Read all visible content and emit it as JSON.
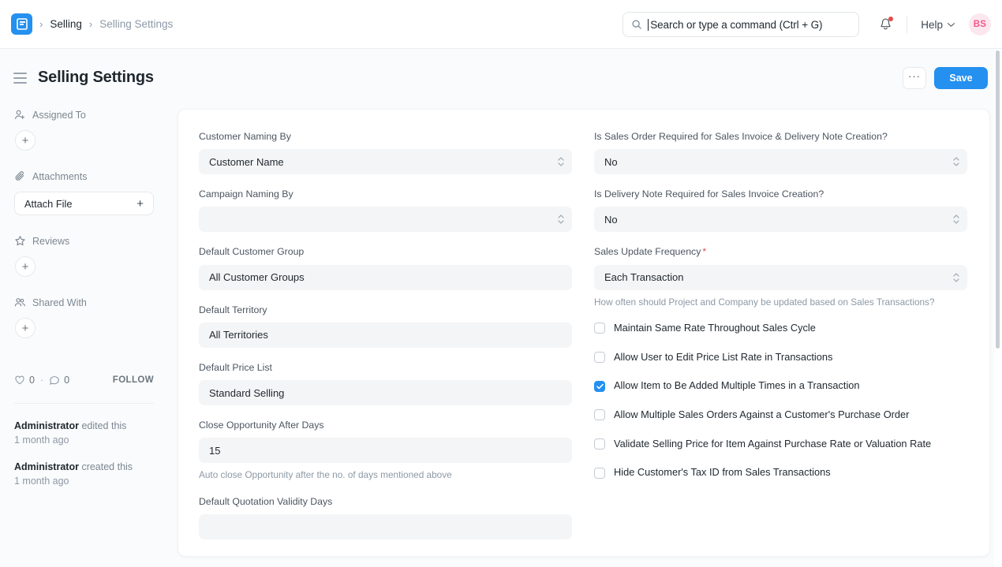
{
  "navbar": {
    "logo_alt": "frappe-logo",
    "breadcrumbs": [
      {
        "label": "Selling",
        "muted": false
      },
      {
        "label": "Selling Settings",
        "muted": true
      }
    ],
    "separator": "›",
    "search": {
      "placeholder": "Search or type a command (Ctrl + G)",
      "value": ""
    },
    "notifications_badge": true,
    "help_label": "Help",
    "avatar_initials": "BS"
  },
  "page_head": {
    "title": "Selling Settings",
    "menu_label": "···",
    "save_label": "Save"
  },
  "sidebar": {
    "sections": [
      {
        "label": "Assigned To",
        "icon": "user-plus-icon",
        "action": "add"
      },
      {
        "label": "Attachments",
        "icon": "paperclip-icon",
        "action": "attach",
        "button_label": "Attach File",
        "button_plus": "+"
      },
      {
        "label": "Reviews",
        "icon": "star-icon",
        "action": "add"
      },
      {
        "label": "Shared With",
        "icon": "users-icon",
        "action": "add"
      }
    ],
    "add_symbol": "+",
    "social": {
      "like_count": "0",
      "comment_count": "0",
      "separator": "·",
      "follow_label": "FOLLOW"
    },
    "activity": [
      {
        "user": "Administrator",
        "action": "edited this",
        "time": "1 month ago"
      },
      {
        "user": "Administrator",
        "action": "created this",
        "time": "1 month ago"
      }
    ]
  },
  "form": {
    "left_fields": [
      {
        "name": "customer-naming-by",
        "label": "Customer Naming By",
        "type": "select",
        "value": "Customer Name",
        "help": ""
      },
      {
        "name": "campaign-naming-by",
        "label": "Campaign Naming By",
        "type": "select",
        "value": "",
        "help": ""
      },
      {
        "name": "default-customer-group",
        "label": "Default Customer Group",
        "type": "link",
        "value": "All Customer Groups",
        "help": ""
      },
      {
        "name": "default-territory",
        "label": "Default Territory",
        "type": "link",
        "value": "All Territories",
        "help": ""
      },
      {
        "name": "default-price-list",
        "label": "Default Price List",
        "type": "link",
        "value": "Standard Selling",
        "help": ""
      },
      {
        "name": "close-opportunity-after-days",
        "label": "Close Opportunity After Days",
        "type": "number",
        "value": "15",
        "help": "Auto close Opportunity after the no. of days mentioned above"
      },
      {
        "name": "default-quotation-validity-days",
        "label": "Default Quotation Validity Days",
        "type": "number",
        "value": "",
        "help": ""
      }
    ],
    "right_fields": [
      {
        "name": "is-sales-order-required",
        "label": "Is Sales Order Required for Sales Invoice & Delivery Note Creation?",
        "type": "select",
        "value": "No",
        "required": false,
        "help": ""
      },
      {
        "name": "is-delivery-note-required",
        "label": "Is Delivery Note Required for Sales Invoice Creation?",
        "type": "select",
        "value": "No",
        "required": false,
        "help": ""
      },
      {
        "name": "sales-update-frequency",
        "label": "Sales Update Frequency",
        "type": "select",
        "value": "Each Transaction",
        "required": true,
        "help": "How often should Project and Company be updated based on Sales Transactions?"
      }
    ],
    "checkboxes": [
      {
        "name": "maintain-same-rate-throughout-sales-cycle",
        "label": "Maintain Same Rate Throughout Sales Cycle",
        "checked": false
      },
      {
        "name": "allow-user-to-edit-price-list-rate",
        "label": "Allow User to Edit Price List Rate in Transactions",
        "checked": false
      },
      {
        "name": "allow-item-to-be-added-multiple-times",
        "label": "Allow Item to Be Added Multiple Times in a Transaction",
        "checked": true
      },
      {
        "name": "allow-multiple-sales-orders",
        "label": "Allow Multiple Sales Orders Against a Customer's Purchase Order",
        "checked": false
      },
      {
        "name": "validate-selling-price",
        "label": "Validate Selling Price for Item Against Purchase Rate or Valuation Rate",
        "checked": false
      },
      {
        "name": "hide-customer-tax-id",
        "label": "Hide Customer's Tax ID from Sales Transactions",
        "checked": false
      }
    ]
  },
  "colors": {
    "accent": "#2490ef",
    "page_bg": "#fafbfc",
    "card_bg": "#ffffff",
    "field_bg": "#f4f5f6",
    "text": "#1f272e",
    "muted_text": "#8d99a6",
    "required": "#e24c4c",
    "avatar_bg": "#fce7ef",
    "avatar_fg": "#ee5a8b"
  }
}
